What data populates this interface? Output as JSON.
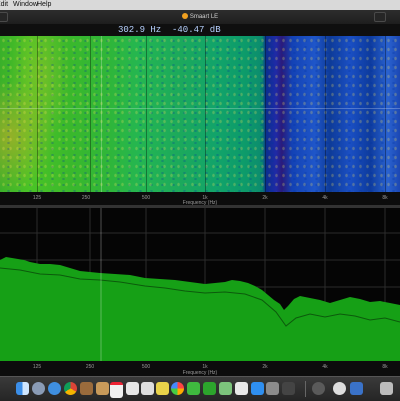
{
  "menubar": {
    "items": [
      "Edit",
      "Window",
      "Help"
    ]
  },
  "window": {
    "title": "Smaart LE"
  },
  "readout": {
    "frequency": "302.9 Hz",
    "level": "-40.47 dB"
  },
  "axis": {
    "ticks": [
      "125",
      "250",
      "500",
      "1k",
      "2k",
      "4k",
      "8k"
    ],
    "label": "Frequency (Hz)"
  },
  "dock": {
    "apps": [
      "finder-icon",
      "launchpad-icon",
      "safari-icon",
      "chrome-icon",
      "contacts-icon",
      "calendar-icon",
      "notes-icon",
      "reminders-icon",
      "photos-icon",
      "messages-icon",
      "facetime-icon",
      "maps-icon",
      "music-icon",
      "appstore-icon",
      "preferences-icon",
      "camera-icon",
      "terminal-icon",
      "activity-icon",
      "smaart-icon",
      "download-icon",
      "trash-icon"
    ]
  }
}
